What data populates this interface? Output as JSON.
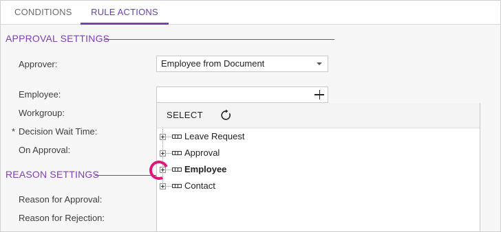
{
  "tabs": [
    {
      "label": "CONDITIONS",
      "active": false
    },
    {
      "label": "RULE ACTIONS",
      "active": true
    }
  ],
  "approval_settings": {
    "title": "APPROVAL SETTINGS",
    "approver_label": "Approver:",
    "approver_value": "Employee from Document",
    "employee_label": "Employee:",
    "employee_value": "",
    "workgroup_label": "Workgroup:",
    "decision_wait_required": "*",
    "decision_wait_label": "Decision Wait Time:",
    "on_approval_label": "On Approval:"
  },
  "reason_settings": {
    "title": "REASON SETTINGS",
    "approval_label": "Reason for Approval:",
    "rejection_label": "Reason for Rejection:"
  },
  "lookup_panel": {
    "select_label": "SELECT",
    "refresh_icon": "refresh-icon",
    "tree_items": [
      {
        "label": "Leave Request",
        "bold": false
      },
      {
        "label": "Approval",
        "bold": false
      },
      {
        "label": "Employee",
        "bold": true
      },
      {
        "label": "Contact",
        "bold": false
      }
    ]
  },
  "colors": {
    "accent": "#7b3fb3",
    "highlight": "#e0147a"
  }
}
